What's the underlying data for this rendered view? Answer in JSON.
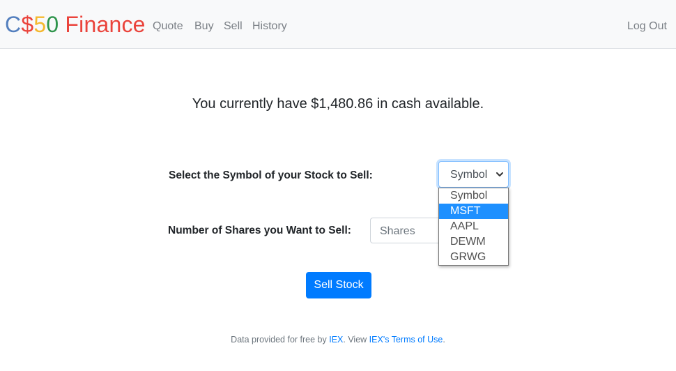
{
  "brand": {
    "c": "C",
    "dollar": "$",
    "five": "5",
    "zero": "0",
    "finance": "Finance"
  },
  "nav": {
    "items": [
      "Quote",
      "Buy",
      "Sell",
      "History"
    ],
    "logout": "Log Out"
  },
  "main": {
    "cash_text": "You currently have $1,480.86 in cash available.",
    "symbol_label": "Select the Symbol of your Stock to Sell:",
    "symbol_select_value": "Symbol",
    "symbol_options": [
      "Symbol",
      "MSFT",
      "AAPL",
      "DEWM",
      "GRWG"
    ],
    "symbol_highlighted": "MSFT",
    "shares_label": "Number of Shares you Want to Sell:",
    "shares_placeholder": "Shares",
    "submit_label": "Sell Stock"
  },
  "footer": {
    "prefix": "Data provided for free by ",
    "iex_link": "IEX",
    "middle": ". View ",
    "terms_link": "IEX's Terms of Use",
    "suffix": "."
  },
  "colors": {
    "brand_blue": "#537fbe",
    "brand_red": "#ea433b",
    "brand_yellow": "#f5b82e",
    "brand_green": "#2e944b",
    "primary": "#007bff",
    "highlight": "#1e90ff"
  }
}
